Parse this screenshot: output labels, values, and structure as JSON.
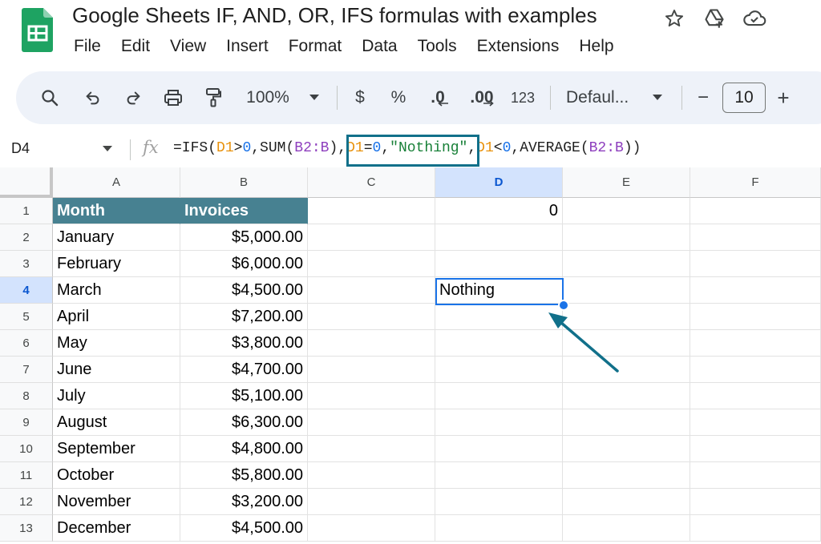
{
  "title": {
    "document_name": "Google Sheets IF, AND, OR, IFS formulas with examples",
    "icons": [
      "star-icon",
      "move-to-drive-icon",
      "cloud-saved-icon"
    ]
  },
  "menu": {
    "items": [
      "File",
      "Edit",
      "View",
      "Insert",
      "Format",
      "Data",
      "Tools",
      "Extensions",
      "Help"
    ]
  },
  "toolbar": {
    "zoom": "100%",
    "currency": "$",
    "percent": "%",
    "decrease_decimal": ".0",
    "increase_decimal": ".00",
    "number_format": "123",
    "font": "Defaul...",
    "font_size": "10",
    "minus": "−",
    "plus": "+"
  },
  "formula_bar": {
    "name_box": "D4",
    "fx": "fx",
    "parts": [
      {
        "text": "=IFS(",
        "color": "default"
      },
      {
        "text": "D1",
        "color": "orange"
      },
      {
        "text": ">",
        "color": "default"
      },
      {
        "text": "0",
        "color": "blue"
      },
      {
        "text": ",SUM(",
        "color": "default"
      },
      {
        "text": "B2:B",
        "color": "purple"
      },
      {
        "text": "),",
        "color": "default"
      },
      {
        "text": "D1",
        "color": "orange"
      },
      {
        "text": "=",
        "color": "default"
      },
      {
        "text": "0",
        "color": "blue"
      },
      {
        "text": ",",
        "color": "default"
      },
      {
        "text": "\"Nothing\"",
        "color": "green"
      },
      {
        "text": ",",
        "color": "default"
      },
      {
        "text": "D1",
        "color": "orange"
      },
      {
        "text": "<",
        "color": "default"
      },
      {
        "text": "0",
        "color": "blue"
      },
      {
        "text": ",AVERAGE(",
        "color": "default"
      },
      {
        "text": "B2:B",
        "color": "purple"
      },
      {
        "text": "))",
        "color": "default"
      }
    ]
  },
  "grid": {
    "columns": [
      "A",
      "B",
      "C",
      "D",
      "E",
      "F"
    ],
    "selected_column": "D",
    "rows": [
      "1",
      "2",
      "3",
      "4",
      "5",
      "6",
      "7",
      "8",
      "9",
      "10",
      "11",
      "12",
      "13"
    ],
    "selected_row": "4",
    "header_row": {
      "a": "Month",
      "b": "Invoices"
    },
    "data": [
      {
        "month": "January",
        "invoice": "$5,000.00"
      },
      {
        "month": "February",
        "invoice": "$6,000.00"
      },
      {
        "month": "March",
        "invoice": "$4,500.00"
      },
      {
        "month": "April",
        "invoice": "$7,200.00"
      },
      {
        "month": "May",
        "invoice": "$3,800.00"
      },
      {
        "month": "June",
        "invoice": "$4,700.00"
      },
      {
        "month": "July",
        "invoice": "$5,100.00"
      },
      {
        "month": "August",
        "invoice": "$6,300.00"
      },
      {
        "month": "September",
        "invoice": "$4,800.00"
      },
      {
        "month": "October",
        "invoice": "$5,800.00"
      },
      {
        "month": "November",
        "invoice": "$3,200.00"
      },
      {
        "month": "December",
        "invoice": "$4,500.00"
      }
    ],
    "d1_value": "0",
    "d4_value": "Nothing"
  },
  "colors": {
    "header_fill": "#478191",
    "highlight_border": "#11708a",
    "selection": "#1a73e8"
  }
}
